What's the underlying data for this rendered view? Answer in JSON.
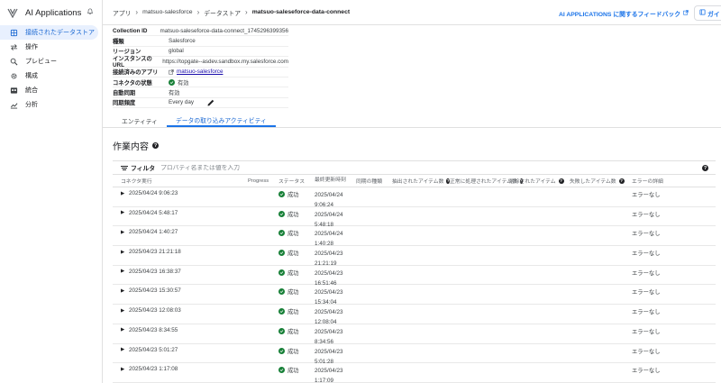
{
  "app": {
    "name": "AI Applications"
  },
  "sidebar": {
    "items": [
      {
        "label": "接続されたデータストア",
        "icon": "database-icon",
        "active": true
      },
      {
        "label": "操作",
        "icon": "arrows-icon",
        "active": false
      },
      {
        "label": "プレビュー",
        "icon": "search-icon",
        "active": false
      },
      {
        "label": "構成",
        "icon": "gear-icon",
        "active": false
      },
      {
        "label": "統合",
        "icon": "integration-icon",
        "active": false
      },
      {
        "label": "分析",
        "icon": "analytics-icon",
        "active": false
      }
    ]
  },
  "breadcrumb": {
    "items": [
      "アプリ",
      "matsuo-salesforce",
      "データストア",
      "matsuo-saleseforce-data-connect"
    ]
  },
  "header": {
    "feedback_label": "AI APPLICATIONS に関するフィードバック",
    "guide_label": "ガイ"
  },
  "details": {
    "rows": [
      {
        "label": "Collection ID",
        "value": "matsuo-saleseforce-data-connect_1745296399356"
      },
      {
        "label": "種類",
        "value": "Salesforce"
      },
      {
        "label": "リージョン",
        "value": "global"
      },
      {
        "label": "インスタンスの URL",
        "value": "https://topgate--asdev.sandbox.my.salesforce.com"
      },
      {
        "label": "接続済みのアプリ",
        "value": "matsuo-salesforce"
      },
      {
        "label": "コネクタの状態",
        "value": "有効"
      },
      {
        "label": "自動同期",
        "value": "有効"
      },
      {
        "label": "同期頻度",
        "value": "Every day"
      }
    ]
  },
  "tabs": [
    {
      "label": "エンティティ",
      "active": false
    },
    {
      "label": "データの取り込みアクティビティ",
      "active": true
    }
  ],
  "section": {
    "title": "作業内容"
  },
  "filter": {
    "label": "フィルタ",
    "placeholder": "プロパティ名または値を入力"
  },
  "table": {
    "columns": [
      "コネクタ実行",
      "Progress",
      "ステータス",
      "最終更新時刻",
      "同期の種類",
      "抽出されたアイテム数",
      "正常に処理されたアイテム数",
      "削除されたアイテム",
      "失敗したアイテム数",
      "エラーの詳細"
    ],
    "rows": [
      {
        "run": "2025/04/24 9:06:23",
        "status": "成功",
        "updated_date": "2025/04/24",
        "updated_time": "9:06:24",
        "error": "エラーなし"
      },
      {
        "run": "2025/04/24 5:48:17",
        "status": "成功",
        "updated_date": "2025/04/24",
        "updated_time": "5:48:18",
        "error": "エラーなし"
      },
      {
        "run": "2025/04/24 1:40:27",
        "status": "成功",
        "updated_date": "2025/04/24",
        "updated_time": "1:40:28",
        "error": "エラーなし"
      },
      {
        "run": "2025/04/23 21:21:18",
        "status": "成功",
        "updated_date": "2025/04/23",
        "updated_time": "21:21:19",
        "error": "エラーなし"
      },
      {
        "run": "2025/04/23 16:38:37",
        "status": "成功",
        "updated_date": "2025/04/23",
        "updated_time": "16:51:46",
        "error": "エラーなし"
      },
      {
        "run": "2025/04/23 15:30:57",
        "status": "成功",
        "updated_date": "2025/04/23",
        "updated_time": "15:34:04",
        "error": "エラーなし"
      },
      {
        "run": "2025/04/23 12:08:03",
        "status": "成功",
        "updated_date": "2025/04/23",
        "updated_time": "12:08:04",
        "error": "エラーなし"
      },
      {
        "run": "2025/04/23 8:34:55",
        "status": "成功",
        "updated_date": "2025/04/23",
        "updated_time": "8:34:56",
        "error": "エラーなし"
      },
      {
        "run": "2025/04/23 5:01:27",
        "status": "成功",
        "updated_date": "2025/04/23",
        "updated_time": "5:01:28",
        "error": "エラーなし"
      },
      {
        "run": "2025/04/23 1:17:08",
        "status": "成功",
        "updated_date": "2025/04/23",
        "updated_time": "1:17:09",
        "error": "エラーなし"
      }
    ]
  },
  "colors": {
    "accent": "#1a73e8",
    "success": "#188038",
    "active_bg": "#e8f0fe"
  }
}
